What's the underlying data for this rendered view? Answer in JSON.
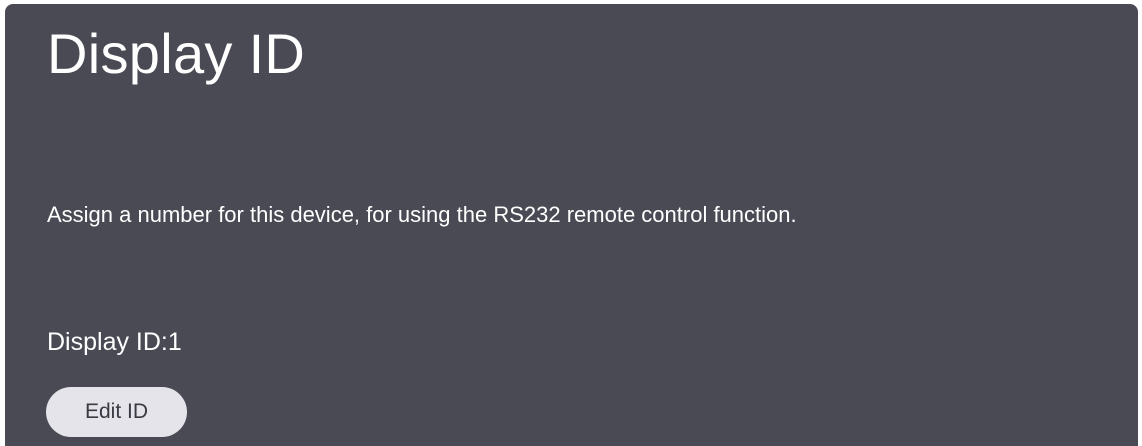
{
  "page": {
    "title": "Display ID",
    "description": "Assign a number for this device, for using the RS232 remote control function.",
    "current_id_text": "Display ID:1",
    "edit_button_label": "Edit ID"
  },
  "colors": {
    "panel_background": "#4a4a55",
    "text": "#ffffff",
    "button_background": "#e4e4ea",
    "button_text": "#3a3a44"
  }
}
